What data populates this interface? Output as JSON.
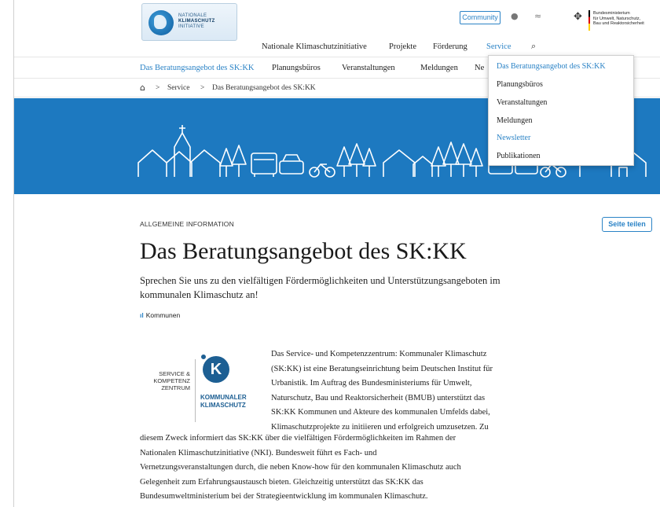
{
  "header": {
    "logo": {
      "line1": "NATIONALE",
      "line2": "KLIMASCHUTZ",
      "line3": "INITIATIVE"
    },
    "community_label": "Community",
    "ministry_lines": [
      "Bundesministerium",
      "für Umwelt, Naturschutz,",
      "Bau und Reaktorsicherheit"
    ],
    "nav": [
      "Nationale Klimaschutzinitiative",
      "Projekte",
      "Förderung",
      "Service"
    ],
    "active_nav": "Service"
  },
  "subnav": [
    "Das Beratungsangebot des SK:KK",
    "Planungsbüros",
    "Veranstaltungen",
    "Meldungen",
    "Ne"
  ],
  "breadcrumb": {
    "sep": ">",
    "items": [
      "Service",
      "Das Beratungsangebot des SK:KK"
    ]
  },
  "dropdown": [
    "Das Beratungsangebot des SK:KK",
    "Planungsbüros",
    "Veranstaltungen",
    "Meldungen",
    "Newsletter",
    "Publikationen"
  ],
  "content": {
    "kicker": "ALLGEMEINE INFORMATION",
    "share_label": "Seite teilen",
    "title": "Das Beratungsangebot des SK:KK",
    "subtitle": "Sprechen Sie uns zu den vielfältigen Fördermöglichkeiten und Unterstützungsangeboten im kommunalen Klimaschutz an!",
    "tag": "Kommunen",
    "sk_logo": {
      "left": [
        "SERVICE &",
        "KOMPETENZ",
        "ZENTRUM"
      ],
      "right": [
        "KOMMUNALER",
        "KLIMASCHUTZ"
      ],
      "mark": "K"
    },
    "body_lines": [
      "Das Service- und Kompetenzzentrum: Kommunaler Klimaschutz",
      "(SK:KK) ist eine Beratungseinrichtung beim Deutschen Institut für",
      "Urbanistik. Im Auftrag des Bundesministeriums für Umwelt,",
      "Naturschutz, Bau und Reaktorsicherheit (BMUB) unterstützt das",
      "SK:KK Kommunen und Akteure des kommunalen Umfelds dabei,",
      "Klimaschutzprojekte zu initiieren und erfolgreich umzusetzen. Zu"
    ],
    "body_full_lines": [
      "diesem Zweck informiert das SK:KK über die vielfältigen Fördermöglichkeiten im Rahmen der",
      "Nationalen Klimaschutzinitiative (NKI). Bundesweit führt es Fach- und",
      "Vernetzungsveranstaltungen durch, die neben Know-how für den kommunalen Klimaschutz auch",
      "Gelegenheit zum Erfahrungsaustausch bieten. Gleichzeitig unterstützt das SK:KK das",
      "Bundesumweltministerium bei der Strategieentwicklung im kommunalen Klimaschutz."
    ]
  },
  "colors": {
    "accent": "#2b83c6",
    "banner": "#1d79c0"
  },
  "icons": [
    "home-icon",
    "search-icon",
    "globe-icon",
    "rss-icon",
    "eagle-icon",
    "bar-chart-icon"
  ]
}
